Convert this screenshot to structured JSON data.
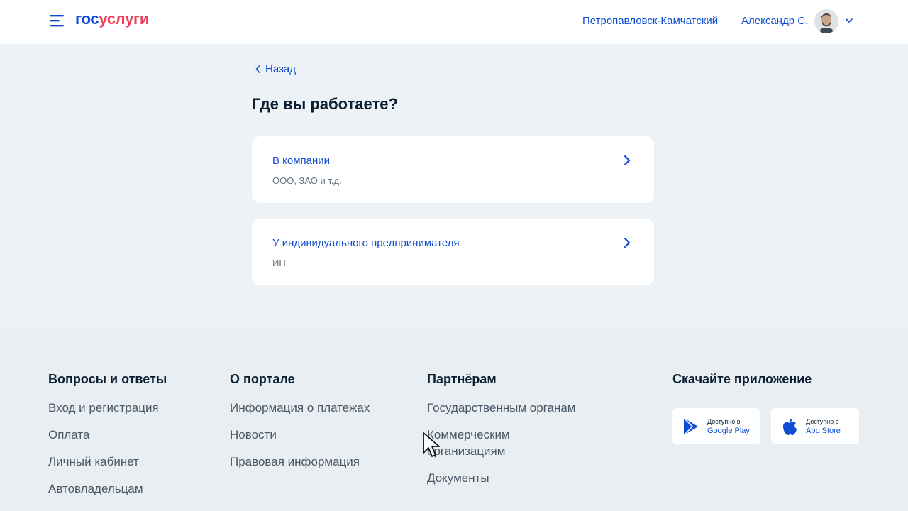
{
  "header": {
    "logo_gos": "гос",
    "logo_uslugi": "услуги",
    "city": "Петропавловск-Камчатский",
    "user_name": "Александр С."
  },
  "main": {
    "back_label": "Назад",
    "title": "Где вы работаете?",
    "options": [
      {
        "title": "В компании",
        "subtitle": "ООО, ЗАО и т.д."
      },
      {
        "title": "У индивидуального предпринимателя",
        "subtitle": "ИП"
      }
    ]
  },
  "footer": {
    "columns": [
      {
        "heading": "Вопросы и ответы",
        "links": [
          "Вход и регистрация",
          "Оплата",
          "Личный кабинет",
          "Автовладельцам"
        ]
      },
      {
        "heading": "О портале",
        "links": [
          "Информация о платежах",
          "Новости",
          "Правовая информация"
        ]
      },
      {
        "heading": "Партнёрам",
        "links": [
          "Государственным органам",
          "Коммерческим организациям",
          "Документы"
        ]
      }
    ],
    "app": {
      "heading": "Скачайте приложение",
      "google_small": "Доступно в",
      "google_big": "Google Play",
      "apple_small": "Доступно в",
      "apple_big": "App Store"
    }
  },
  "colors": {
    "accent": "#0d4cd3",
    "logo_red": "#ee3f58",
    "page_bg": "#edf2f6",
    "footer_bg": "#e8eef2"
  },
  "icons": [
    "menu-icon",
    "chevron-down-icon",
    "chevron-left-icon",
    "chevron-right-icon",
    "google-play-icon",
    "apple-icon",
    "mouse-cursor-icon"
  ]
}
